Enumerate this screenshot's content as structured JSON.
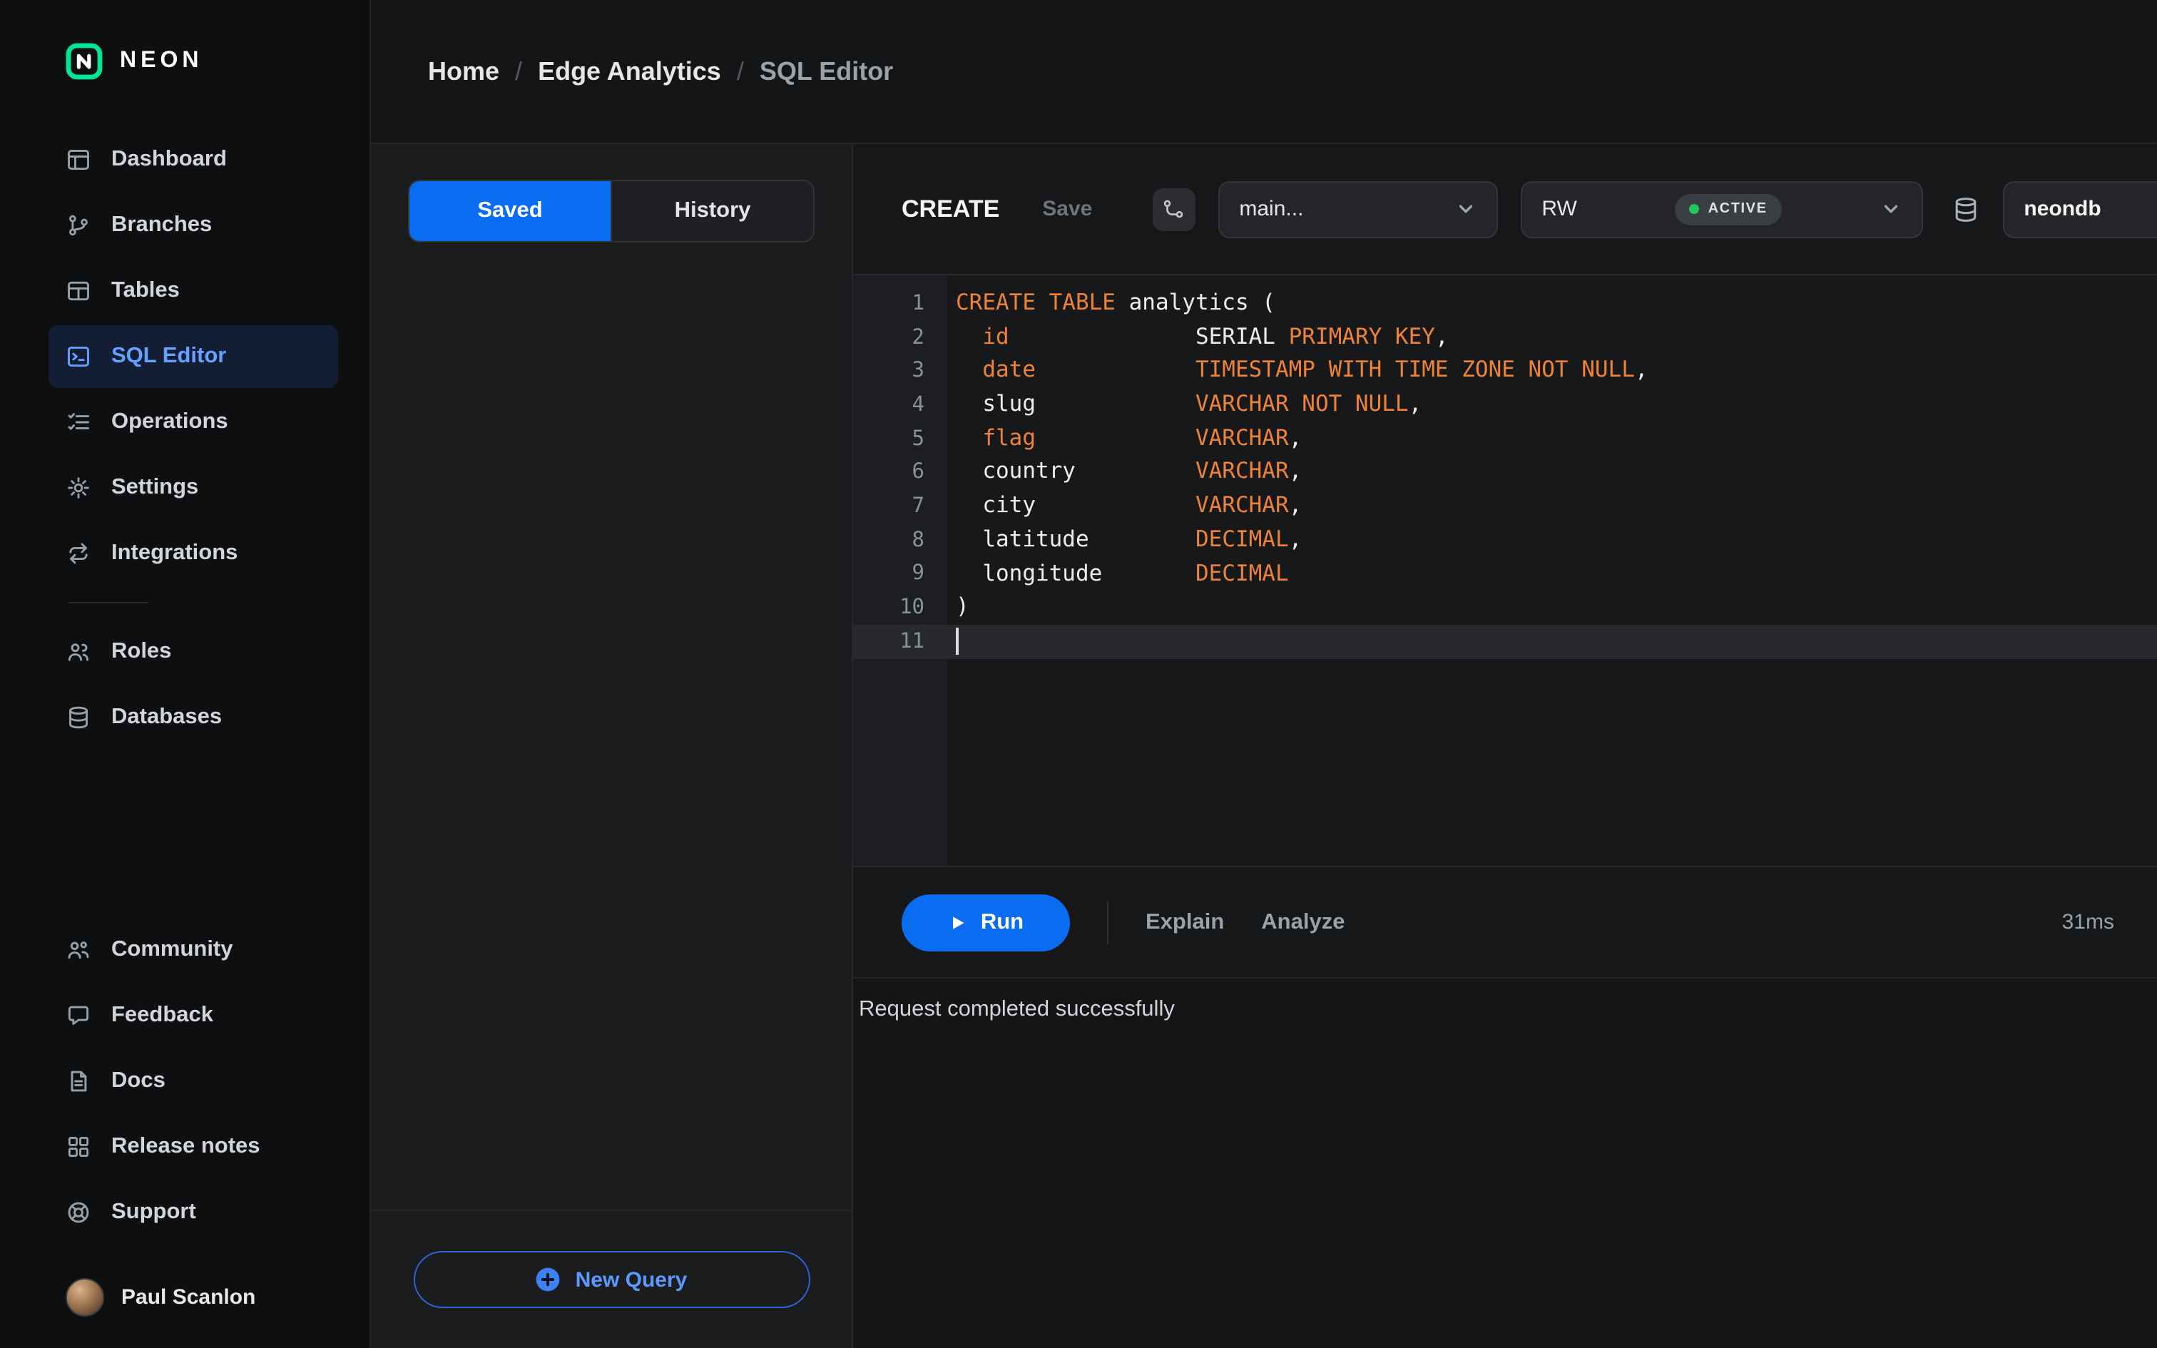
{
  "colors": {
    "accent": "#0a6cf0",
    "brand": "#00e599",
    "keyword": "#ee8337",
    "ok": "#23c55e"
  },
  "sidebar": {
    "logo_text": "NEON",
    "primary_items": [
      {
        "label": "Dashboard",
        "icon": "dashboard",
        "active": false
      },
      {
        "label": "Branches",
        "icon": "branches",
        "active": false
      },
      {
        "label": "Tables",
        "icon": "tables",
        "active": false
      },
      {
        "label": "SQL Editor",
        "icon": "sql-editor",
        "active": true
      },
      {
        "label": "Operations",
        "icon": "operations",
        "active": false
      },
      {
        "label": "Settings",
        "icon": "settings",
        "active": false
      },
      {
        "label": "Integrations",
        "icon": "integrations",
        "active": false
      }
    ],
    "secondary_items": [
      {
        "label": "Roles",
        "icon": "roles",
        "active": false
      },
      {
        "label": "Databases",
        "icon": "databases",
        "active": false
      }
    ],
    "footer_items": [
      {
        "label": "Community",
        "icon": "community",
        "active": false
      },
      {
        "label": "Feedback",
        "icon": "feedback",
        "active": false
      },
      {
        "label": "Docs",
        "icon": "docs",
        "active": false
      },
      {
        "label": "Release notes",
        "icon": "release-notes",
        "active": false
      },
      {
        "label": "Support",
        "icon": "support",
        "active": false
      }
    ],
    "user": {
      "name": "Paul Scanlon"
    }
  },
  "breadcrumb": {
    "separator": "/",
    "items": [
      {
        "label": "Home",
        "current": false
      },
      {
        "label": "Edge Analytics",
        "current": false
      },
      {
        "label": "SQL Editor",
        "current": true
      }
    ]
  },
  "queries_panel": {
    "tabs": [
      {
        "label": "Saved",
        "active": true
      },
      {
        "label": "History",
        "active": false
      }
    ],
    "new_query_label": "New Query"
  },
  "editor": {
    "title": "CREATE",
    "save_label": "Save",
    "branch_selector": {
      "value": "main..."
    },
    "compute_selector": {
      "value": "RW",
      "status": "ACTIVE"
    },
    "database_selector": {
      "value": "neondb"
    },
    "code": {
      "lines": [
        {
          "tokens": [
            {
              "c": "kw",
              "t": "CREATE TABLE"
            },
            {
              "c": "pl",
              "t": " analytics ("
            }
          ]
        },
        {
          "tokens": [
            {
              "c": "pl",
              "t": "  "
            },
            {
              "c": "kw",
              "t": "id"
            },
            {
              "c": "pl",
              "t": "              SERIAL "
            },
            {
              "c": "kw",
              "t": "PRIMARY KEY"
            },
            {
              "c": "pl",
              "t": ","
            }
          ]
        },
        {
          "tokens": [
            {
              "c": "pl",
              "t": "  "
            },
            {
              "c": "kw",
              "t": "date"
            },
            {
              "c": "pl",
              "t": "            "
            },
            {
              "c": "kw",
              "t": "TIMESTAMP WITH TIME ZONE NOT NULL"
            },
            {
              "c": "pl",
              "t": ","
            }
          ]
        },
        {
          "tokens": [
            {
              "c": "pl",
              "t": "  slug            "
            },
            {
              "c": "kw",
              "t": "VARCHAR NOT NULL"
            },
            {
              "c": "pl",
              "t": ","
            }
          ]
        },
        {
          "tokens": [
            {
              "c": "pl",
              "t": "  "
            },
            {
              "c": "kw",
              "t": "flag"
            },
            {
              "c": "pl",
              "t": "            "
            },
            {
              "c": "kw",
              "t": "VARCHAR"
            },
            {
              "c": "pl",
              "t": ","
            }
          ]
        },
        {
          "tokens": [
            {
              "c": "pl",
              "t": "  country         "
            },
            {
              "c": "kw",
              "t": "VARCHAR"
            },
            {
              "c": "pl",
              "t": ","
            }
          ]
        },
        {
          "tokens": [
            {
              "c": "pl",
              "t": "  city            "
            },
            {
              "c": "kw",
              "t": "VARCHAR"
            },
            {
              "c": "pl",
              "t": ","
            }
          ]
        },
        {
          "tokens": [
            {
              "c": "pl",
              "t": "  latitude        "
            },
            {
              "c": "kw",
              "t": "DECIMAL"
            },
            {
              "c": "pl",
              "t": ","
            }
          ]
        },
        {
          "tokens": [
            {
              "c": "pl",
              "t": "  longitude       "
            },
            {
              "c": "kw",
              "t": "DECIMAL"
            }
          ]
        },
        {
          "tokens": [
            {
              "c": "pl",
              "t": ")"
            }
          ]
        },
        {
          "tokens": [],
          "active": true,
          "cursor": true
        }
      ]
    },
    "actions": {
      "run": "Run",
      "explain": "Explain",
      "analyze": "Analyze"
    },
    "duration": "31ms",
    "status_message": "Request completed successfully"
  }
}
